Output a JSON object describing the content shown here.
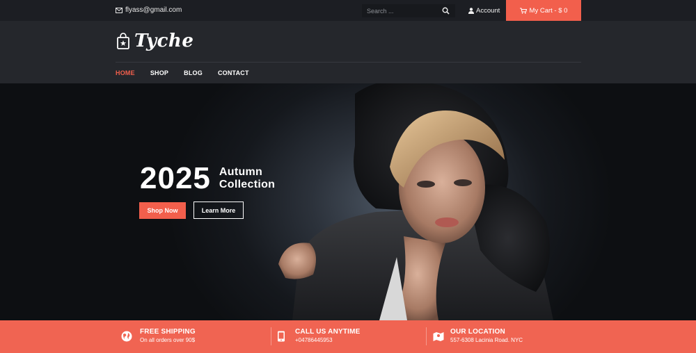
{
  "topbar": {
    "email": "flyass@gmail.com",
    "search_placeholder": "Search ...",
    "account_label": "Account",
    "cart_label": "My Cart - $ 0"
  },
  "header": {
    "brand": "Tyche",
    "nav": [
      "HOME",
      "SHOP",
      "BLOG",
      "CONTACT"
    ],
    "active_nav": "HOME"
  },
  "hero": {
    "year": "2025",
    "title_line1": "Autumn",
    "title_line2": "Collection",
    "primary_button": "Shop Now",
    "secondary_button": "Learn More"
  },
  "features": [
    {
      "icon": "globe-icon",
      "title": "FREE SHIPPING",
      "subtitle": "On all orders over 90$"
    },
    {
      "icon": "phone-icon",
      "title": "CALL US ANYTIME",
      "subtitle": "+04786445953"
    },
    {
      "icon": "map-icon",
      "title": "OUR LOCATION",
      "subtitle": "557-6308 Lacinia Road. NYC"
    }
  ],
  "colors": {
    "accent": "#f25f4c",
    "topbar_bg": "#1c1e23",
    "header_bg": "#25272c",
    "features_bg": "#f06452"
  }
}
